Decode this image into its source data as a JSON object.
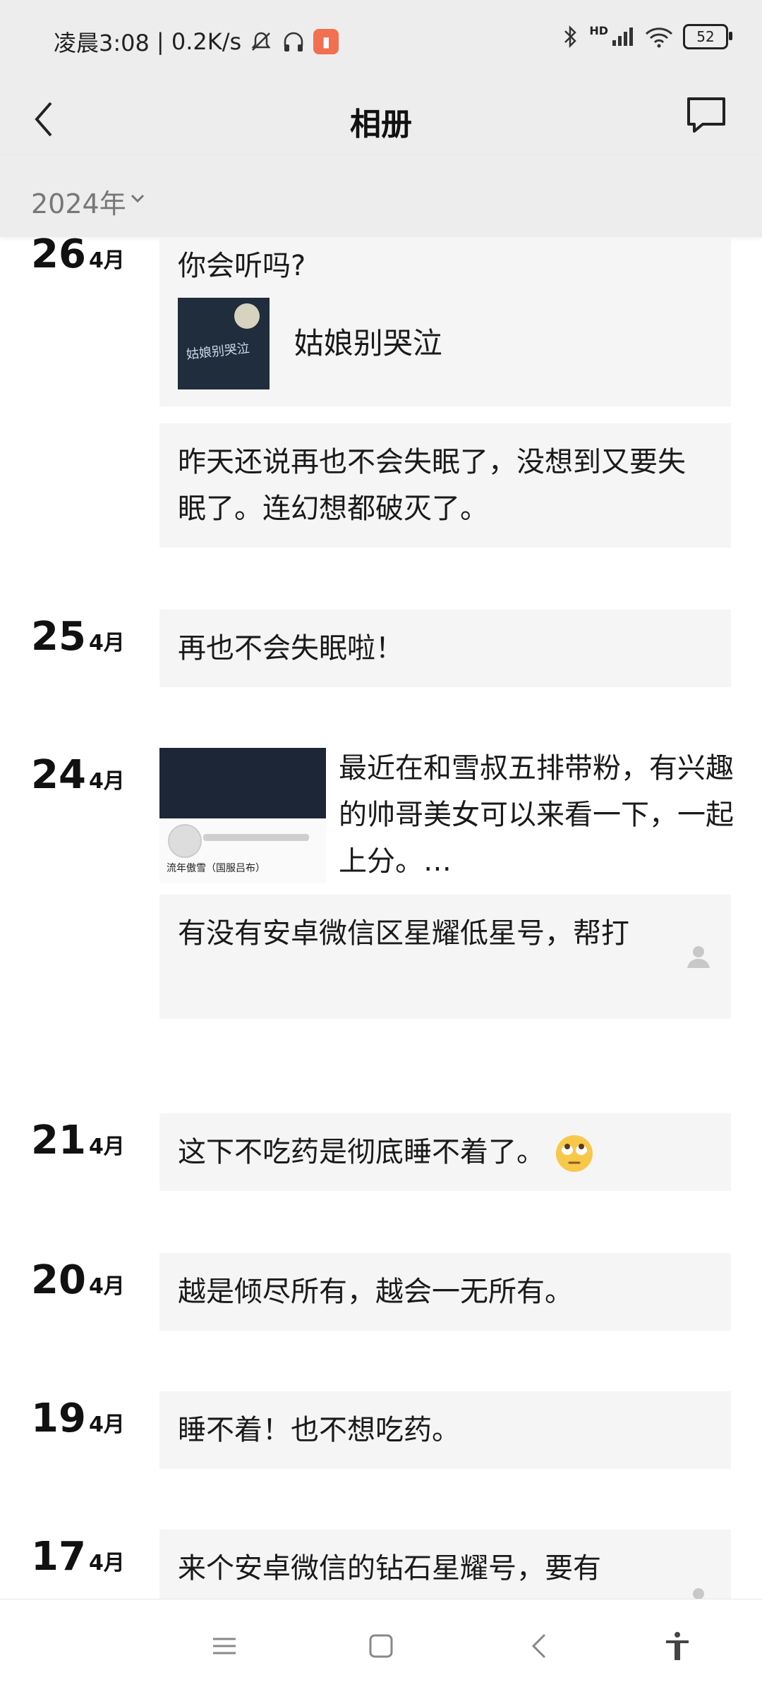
{
  "status": {
    "time": "凌晨3:08",
    "speed": "| 0.2K/s",
    "network": "HD",
    "battery": "52"
  },
  "header": {
    "title": "相册"
  },
  "filter": {
    "year": "2024年"
  },
  "entries": [
    {
      "day": "26",
      "month": "4月",
      "posts": [
        {
          "text": "你会听吗?",
          "music_title": "姑娘别哭泣",
          "music_cover_text": "姑娘别哭泣"
        },
        {
          "text": "昨天还说再也不会失眠了，没想到又要失眠了。连幻想都破灭了。"
        }
      ]
    },
    {
      "day": "25",
      "month": "4月",
      "posts": [
        {
          "text": "再也不会失眠啦！"
        }
      ]
    },
    {
      "day": "24",
      "month": "4月",
      "posts": [
        {
          "text": "最近在和雪叔五排带粉，有兴趣的帅哥美女可以来看一下，一起上分。…",
          "thumb_name": "流年傲雪（国服吕布）"
        },
        {
          "text": "有没有安卓微信区星耀低星号，帮打"
        }
      ]
    },
    {
      "day": "21",
      "month": "4月",
      "posts": [
        {
          "text": "这下不吃药是彻底睡不着了。"
        }
      ]
    },
    {
      "day": "20",
      "month": "4月",
      "posts": [
        {
          "text": "越是倾尽所有，越会一无所有。"
        }
      ]
    },
    {
      "day": "19",
      "month": "4月",
      "posts": [
        {
          "text": "睡不着！也不想吃药。"
        }
      ]
    },
    {
      "day": "17",
      "month": "4月",
      "posts": [
        {
          "text": "来个安卓微信的钻石星耀号，要有"
        }
      ]
    }
  ]
}
